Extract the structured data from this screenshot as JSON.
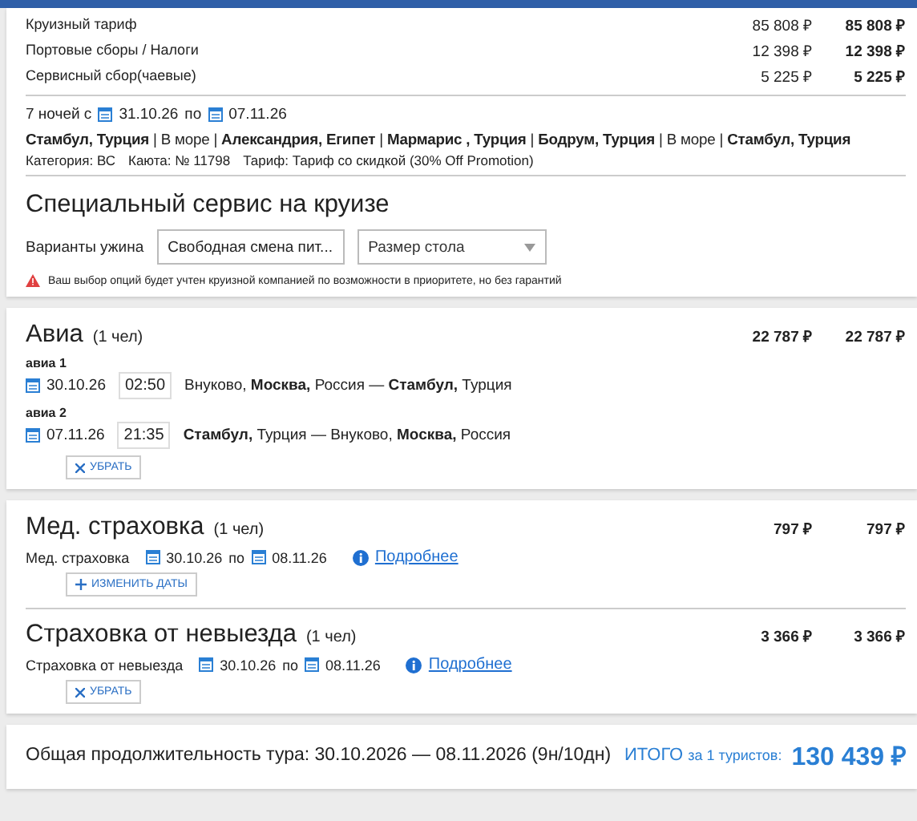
{
  "cruise": {
    "prices": [
      {
        "label": "Круизный тариф",
        "price": "85 808 ₽",
        "total": "85 808 ₽"
      },
      {
        "label": "Портовые сборы / Налоги",
        "price": "12 398 ₽",
        "total": "12 398 ₽"
      },
      {
        "label": "Сервисный сбор(чаевые)",
        "price": "5 225 ₽",
        "total": "5 225 ₽"
      }
    ],
    "dates": {
      "prefix": "7 ночей с",
      "from": "31.10.26",
      "sep": "по",
      "to": "07.11.26"
    },
    "route": "**Стамбул, Турция** | В море | **Александрия, Египет** | **Мармарис , Турция** | **Бодрум, Турция** | В море | **Стамбул, Турция**",
    "details": [
      "Категория: ВС",
      "Каюта: № 11798",
      "Тариф: Тариф со скидкой (30% Off Promotion)"
    ]
  },
  "special": {
    "title": "Специальный сервис на круизе",
    "label": "Варианты ужина",
    "selects": [
      {
        "value": "Свободная смена пит..."
      },
      {
        "placeholder": "Размер стола"
      }
    ],
    "warning": "Ваш выбор опций будет учтен круизной компанией по возможности в приоритете, но без гарантий"
  },
  "avia": {
    "title": "Авиа",
    "pax": "(1 чел)",
    "price": "22 787 ₽",
    "total": "22 787 ₽",
    "flights": [
      {
        "label": "авиа 1",
        "date": "30.10.26",
        "time": "02:50",
        "route": "Внуково, **Москва,** Россия — **Стамбул,** Турция"
      },
      {
        "label": "авиа 2",
        "date": "07.11.26",
        "time": "21:35",
        "route": "**Стамбул,** Турция — Внуково, **Москва,** Россия"
      }
    ],
    "button": {
      "kind": "remove",
      "label": "УБРАТЬ"
    }
  },
  "insurance": [
    {
      "title": "Мед. страховка",
      "pax": "(1 чел)",
      "price": "797 ₽",
      "total": "797 ₽",
      "name": "Мед. страховка",
      "from": "30.10.26",
      "sep": "по",
      "to": "08.11.26",
      "link": "Подробнее",
      "button": {
        "kind": "add",
        "label": "ИЗМЕНИТЬ ДАТЫ"
      }
    },
    {
      "title": "Страховка от невыезда",
      "pax": "(1 чел)",
      "price": "3 366 ₽",
      "total": "3 366 ₽",
      "name": "Страховка от невыезда",
      "from": "30.10.26",
      "sep": "по",
      "to": "08.11.26",
      "link": "Подробнее",
      "button": {
        "kind": "remove",
        "label": "УБРАТЬ"
      }
    }
  ],
  "summary": {
    "duration": "Общая продолжительность тура: 30.10.2026 — 08.11.2026 (9н/10дн)",
    "total_label": "ИТОГО",
    "tourists": "за 1 туристов:",
    "total": "130 439 ₽"
  }
}
